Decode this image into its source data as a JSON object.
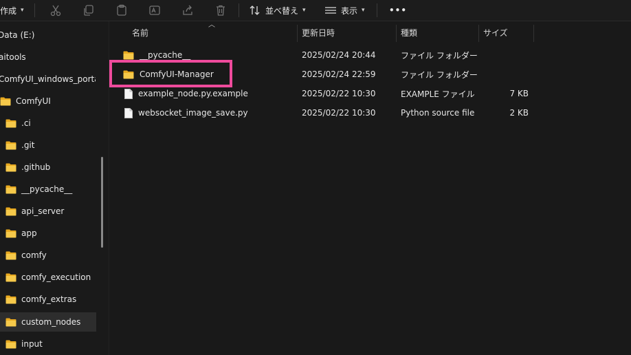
{
  "toolbar": {
    "new_label": "作成",
    "sort_label": "並べ替え",
    "view_label": "表示",
    "more_label": "•••"
  },
  "nav": {
    "items": [
      {
        "label": "Data (E:)"
      },
      {
        "label": "aitools"
      },
      {
        "label": "ComfyUI_windows_portable"
      },
      {
        "label": "ComfyUI"
      },
      {
        "label": ".ci"
      },
      {
        "label": ".git"
      },
      {
        "label": ".github"
      },
      {
        "label": "__pycache__"
      },
      {
        "label": "api_server"
      },
      {
        "label": "app"
      },
      {
        "label": "comfy"
      },
      {
        "label": "comfy_execution"
      },
      {
        "label": "comfy_extras"
      },
      {
        "label": "custom_nodes"
      },
      {
        "label": "input"
      }
    ]
  },
  "columns": {
    "name": "名前",
    "date": "更新日時",
    "type": "種類",
    "size": "サイズ"
  },
  "files": [
    {
      "name": "__pycache__",
      "date": "2025/02/24 20:44",
      "type": "ファイル フォルダー",
      "size": ""
    },
    {
      "name": "ComfyUI-Manager",
      "date": "2025/02/24 22:59",
      "type": "ファイル フォルダー",
      "size": ""
    },
    {
      "name": "example_node.py.example",
      "date": "2025/02/22 10:30",
      "type": "EXAMPLE ファイル",
      "size": "7 KB"
    },
    {
      "name": "websocket_image_save.py",
      "date": "2025/02/22 10:30",
      "type": "Python source file",
      "size": "2 KB"
    }
  ],
  "colors": {
    "folder": "#f3c241",
    "highlight": "#ef4b9c"
  }
}
